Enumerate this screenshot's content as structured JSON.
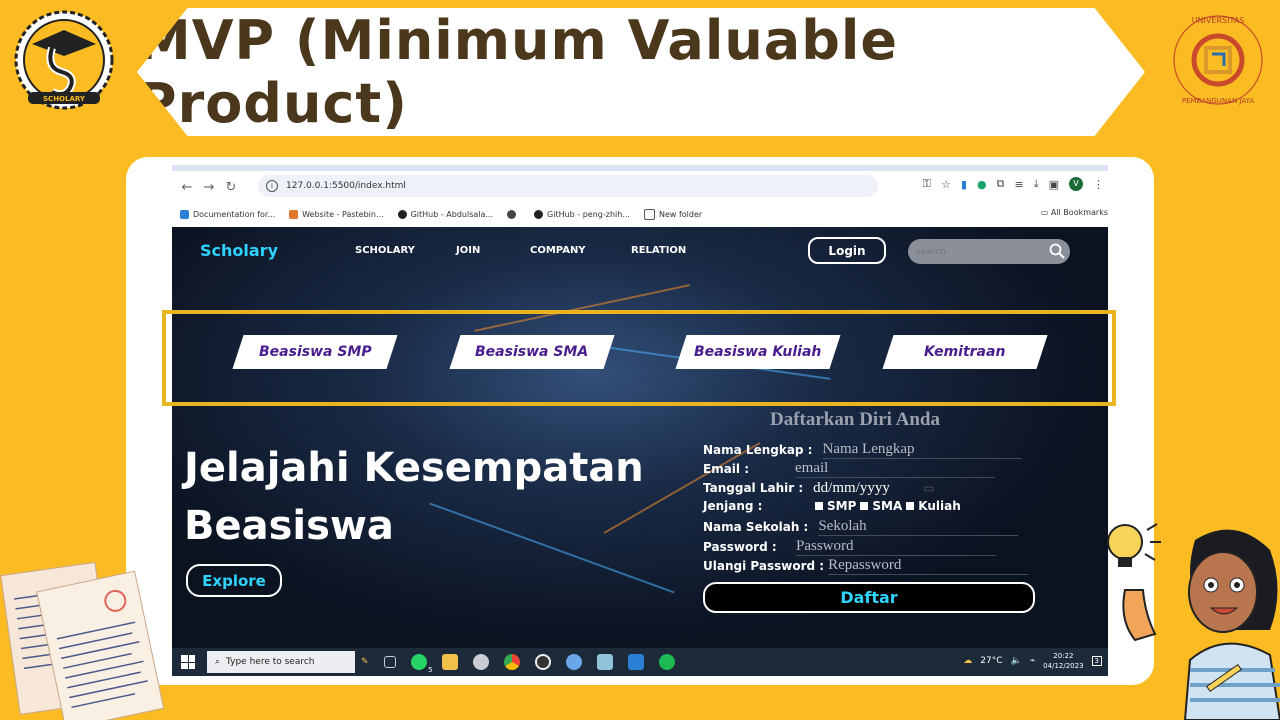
{
  "slide": {
    "title": "MVP (Minimum Valuable Product)",
    "left_logo_text": "SCHOLARY",
    "right_logo_text": "UNIVERSITAS PEMBANGUNAN JAYA"
  },
  "browser": {
    "url": "127.0.0.1:5500/index.html",
    "bookmarks": [
      {
        "label": "Documentation for...",
        "color": "#2b7fd4"
      },
      {
        "label": "Website - Pastebin...",
        "color": "#e07a2a"
      },
      {
        "label": "GitHub - Abdulsala...",
        "color": "#222222"
      },
      {
        "label": "",
        "color": "#444444"
      },
      {
        "label": "GitHub - peng-zhih...",
        "color": "#222222"
      },
      {
        "label": "New folder",
        "color": "#555555"
      }
    ],
    "all_bookmarks": "All Bookmarks",
    "profile_initial": "V"
  },
  "site": {
    "brand": "Scholary",
    "nav": [
      "SCHOLARY",
      "JOIN",
      "COMPANY",
      "RELATION"
    ],
    "login": "Login",
    "search_placeholder": "search",
    "categories": [
      "Beasiswa SMP",
      "Beasiswa SMA",
      "Beasiswa Kuliah",
      "Kemitraan"
    ],
    "hero_line1": "Jelajahi Kesempatan",
    "hero_line2": "Beasiswa",
    "explore": "Explore",
    "form": {
      "title": "Daftarkan Diri Anda",
      "name_label": "Nama Lengkap :",
      "name_placeholder": "Nama Lengkap",
      "email_label": "Email :",
      "email_placeholder": "email",
      "dob_label": "Tanggal Lahir :",
      "dob_value": "dd/mm/yyyy",
      "level_label": "Jenjang :",
      "levels": [
        "SMP",
        "SMA",
        "Kuliah"
      ],
      "school_label": "Nama Sekolah :",
      "school_placeholder": "Sekolah",
      "password_label": "Password :",
      "password_placeholder": "Password",
      "repassword_label": "Ulangi Password :",
      "repassword_placeholder": "Repassword",
      "submit": "Daftar"
    }
  },
  "taskbar": {
    "search_placeholder": "Type here to search",
    "weather": "27°C",
    "time": "20:22",
    "date": "04/12/2023",
    "whatsapp_badge": "5",
    "notification_badge": "3"
  }
}
